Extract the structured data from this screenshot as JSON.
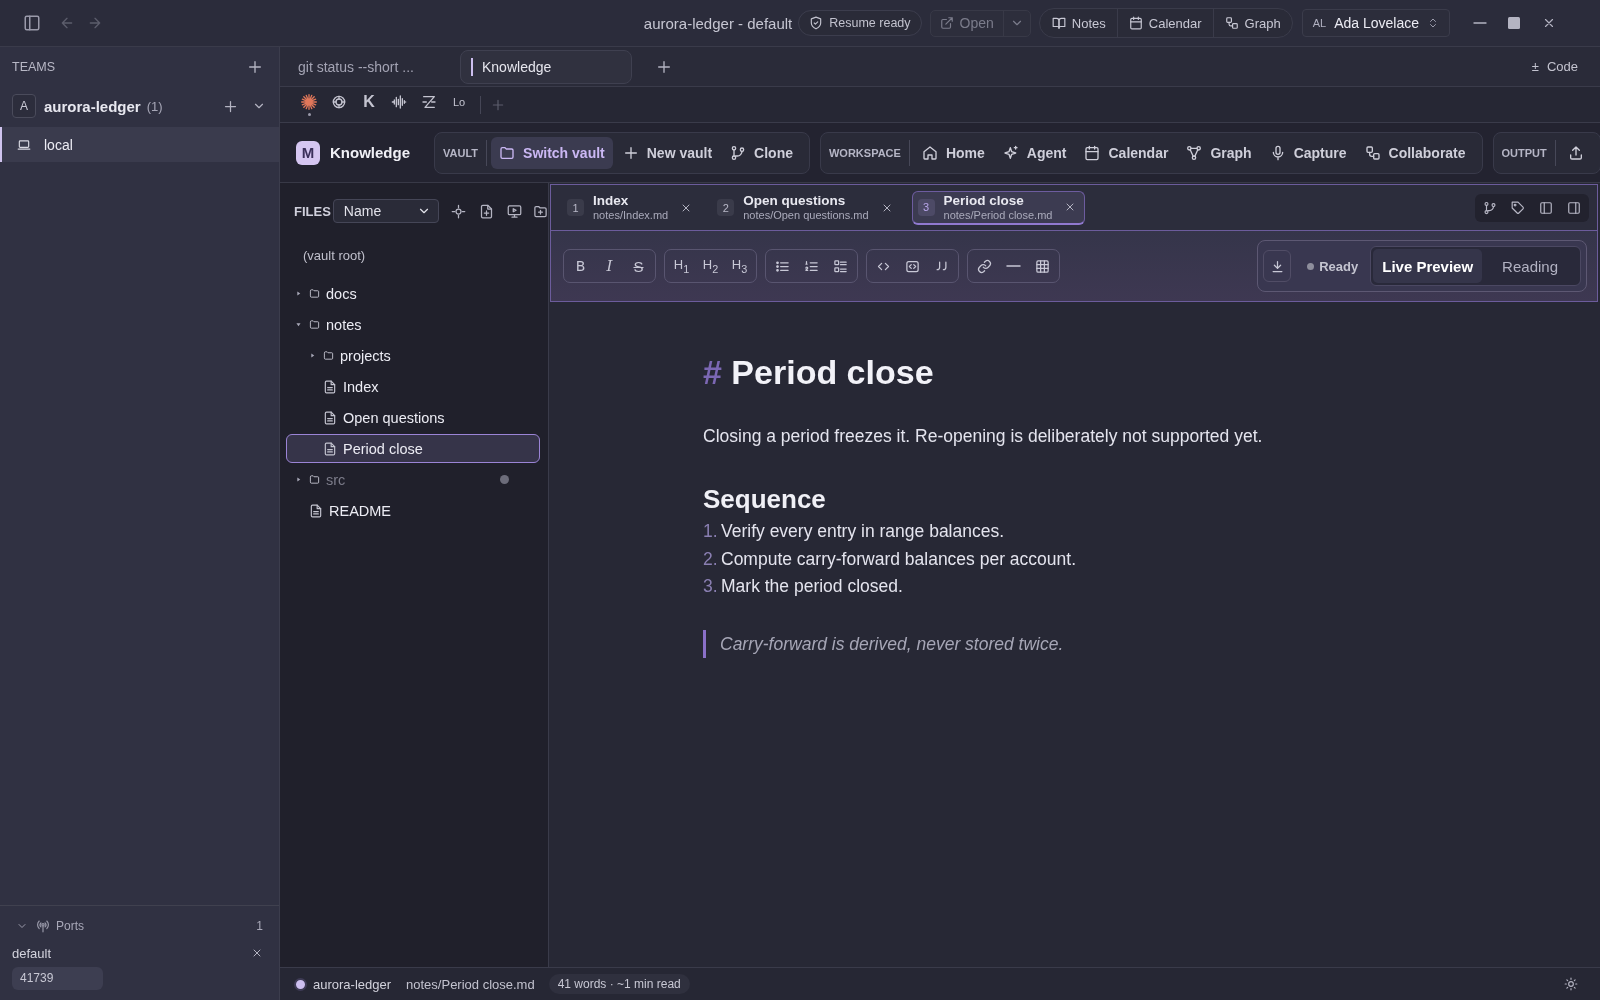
{
  "titlebar": {
    "title": "aurora-ledger - default",
    "status": "Resume ready",
    "open_button": {
      "label": "Open",
      "disabled": true
    },
    "views": [
      {
        "label": "Notes"
      },
      {
        "label": "Calendar"
      },
      {
        "label": "Graph"
      }
    ],
    "user": {
      "initials": "AL",
      "name": "Ada Lovelace"
    }
  },
  "sidebar": {
    "header": "TEAMS",
    "teams": [
      {
        "initial": "A",
        "name": "aurora-ledger",
        "count": "(1)"
      }
    ],
    "items": [
      {
        "label": "local",
        "selected": true
      }
    ],
    "ports": {
      "title": "Ports",
      "count": "1",
      "expanded": true,
      "entries": [
        {
          "name": "default",
          "port": "41739"
        }
      ]
    }
  },
  "session_tabs": [
    {
      "label": "git status --short ...",
      "selected": false
    },
    {
      "label": "Knowledge",
      "selected": true
    }
  ],
  "code_toggle": {
    "icon": "±",
    "label": "Code"
  },
  "app_strip": [
    {
      "kind": "logo",
      "selected": true
    },
    {
      "kind": "logo",
      "selected": false
    },
    {
      "kind": "text",
      "label": "K",
      "selected": false
    },
    {
      "kind": "logo",
      "selected": false
    },
    {
      "kind": "logo",
      "selected": false
    },
    {
      "kind": "text",
      "label": "Lo",
      "selected": false
    }
  ],
  "module": {
    "logo": "M",
    "name": "Knowledge",
    "groups": [
      {
        "title": "VAULT",
        "actions": [
          {
            "label": "Switch vault",
            "selected": true
          },
          {
            "label": "New vault",
            "selected": false
          },
          {
            "label": "Clone",
            "selected": false
          }
        ]
      },
      {
        "title": "WORKSPACE",
        "actions": [
          {
            "label": "Home",
            "selected": false
          },
          {
            "label": "Agent",
            "selected": false
          },
          {
            "label": "Calendar",
            "selected": false
          },
          {
            "label": "Graph",
            "selected": false
          },
          {
            "label": "Capture",
            "selected": false
          },
          {
            "label": "Collaborate",
            "selected": false
          }
        ]
      },
      {
        "title": "OUTPUT",
        "actions": [
          {
            "selected": false
          }
        ]
      }
    ]
  },
  "files": {
    "title": "FILES",
    "sort": "Name",
    "root": "(vault root)",
    "tree": [
      {
        "kind": "folder",
        "name": "docs",
        "expanded": false,
        "selected": false,
        "dimmed": false
      },
      {
        "kind": "folder",
        "name": "notes",
        "expanded": true,
        "selected": false,
        "dimmed": false,
        "children": [
          {
            "kind": "folder",
            "name": "projects",
            "expanded": false,
            "selected": false,
            "dimmed": false
          },
          {
            "kind": "file",
            "name": "Index",
            "selected": false,
            "dimmed": false
          },
          {
            "kind": "file",
            "name": "Open questions",
            "selected": false,
            "dimmed": false
          },
          {
            "kind": "file",
            "name": "Period close",
            "selected": true,
            "dimmed": false
          }
        ]
      },
      {
        "kind": "folder",
        "name": "src",
        "expanded": false,
        "selected": false,
        "dimmed": true
      },
      {
        "kind": "file",
        "name": "README",
        "selected": false,
        "dimmed": false
      }
    ]
  },
  "editor": {
    "tabs": [
      {
        "number": "1",
        "title": "Index",
        "path": "notes/Index.md",
        "selected": false
      },
      {
        "number": "2",
        "title": "Open questions",
        "path": "notes/Open questions.md",
        "selected": false
      },
      {
        "number": "3",
        "title": "Period close",
        "path": "notes/Period close.md",
        "selected": true
      }
    ],
    "format_text_groups": [
      [
        "B",
        "I",
        "S"
      ],
      [
        "H$_{1}$",
        "H$_{2}$",
        "H$_{3}$"
      ]
    ],
    "status": "Ready",
    "view_modes": [
      {
        "label": "Live Preview",
        "selected": true
      },
      {
        "label": "Reading",
        "selected": false
      }
    ]
  },
  "document": {
    "blocks": [
      {
        "kind": "h1",
        "mark": "#",
        "text": "Period close"
      },
      {
        "kind": "paragraph",
        "text": "Closing a period freezes it. Re-opening is deliberately not supported yet."
      },
      {
        "kind": "h2",
        "text": "Sequence"
      },
      {
        "kind": "ordered_list",
        "items": [
          {
            "number": "1.",
            "text": "Verify every entry in range balances."
          },
          {
            "number": "2.",
            "text": "Compute carry-forward balances per account."
          },
          {
            "number": "3.",
            "text": "Mark the period closed."
          }
        ]
      },
      {
        "kind": "quote",
        "text": "Carry-forward is derived, never stored twice."
      }
    ]
  },
  "status_bar": {
    "vault": "aurora-ledger",
    "path": "notes/Period close.md",
    "stats": "41 words · ~1 min read"
  }
}
